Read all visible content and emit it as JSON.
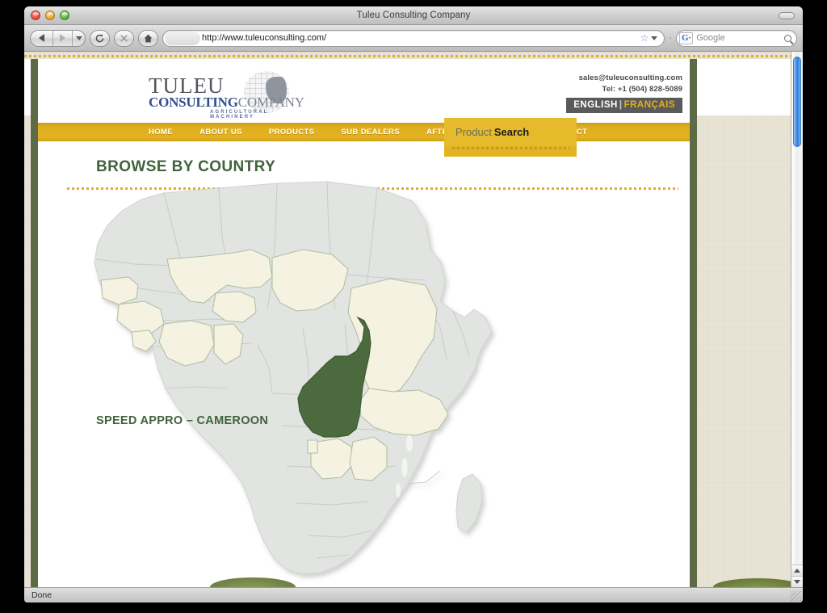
{
  "browser": {
    "window_title": "Tuleu Consulting Company",
    "url": "http://www.tuleuconsulting.com/",
    "search_placeholder": "Google",
    "search_engine_badge": "G",
    "status_text": "Done",
    "back_icon": "back-arrow-icon",
    "forward_icon": "forward-arrow-icon",
    "dropdown_icon": "chevron-down-icon",
    "reload_icon": "reload-icon",
    "stop_icon": "stop-icon",
    "home_icon": "home-icon",
    "bookmark_icon": "star-icon",
    "magnifier_icon": "search-icon"
  },
  "site": {
    "logo": {
      "line1": "TULEU",
      "line2_a": "CONSULTING",
      "line2_b": "COMPANY",
      "tagline": "AGRICULTURAL MACHINERY"
    },
    "contact": {
      "email": "sales@tuleuconsulting.com",
      "phone": "Tel: +1 (504) 828-5089"
    },
    "languages": {
      "english": "ENGLISH",
      "separator": "|",
      "francais": "FRANÇAIS"
    },
    "nav": [
      {
        "label": "HOME"
      },
      {
        "label": "ABOUT US"
      },
      {
        "label": "PRODUCTS"
      },
      {
        "label": "SUB DEALERS"
      },
      {
        "label": "AFTER SALES SERVICE"
      },
      {
        "label": "CONTACT"
      }
    ],
    "product_search": {
      "label_light": "Product",
      "label_bold": "Search"
    },
    "main": {
      "page_title": "BROWSE BY COUNTRY",
      "selected_country_label": "SPEED APPRO – CAMEROON"
    }
  },
  "map": {
    "type": "choropleth",
    "region": "Africa",
    "highlighted_country": "Cameroon",
    "highlight_color": "#4c6b3c",
    "neighbor_color": "#f6f2e2",
    "base_color": "#e2e4e1",
    "border_color": "#b8c3ae",
    "neighbor_countries": [
      "Chad",
      "Central African Republic",
      "Niger",
      "Mali",
      "Burkina Faso",
      "Gabon",
      "Equatorial Guinea",
      "Republic of the Congo"
    ]
  },
  "colors": {
    "gold_nav": "#e3b324",
    "green_accent": "#40633b",
    "green_border": "#5c6b46",
    "page_beige": "#e9e4d6",
    "lang_bar_bg": "#5a5a5a"
  }
}
